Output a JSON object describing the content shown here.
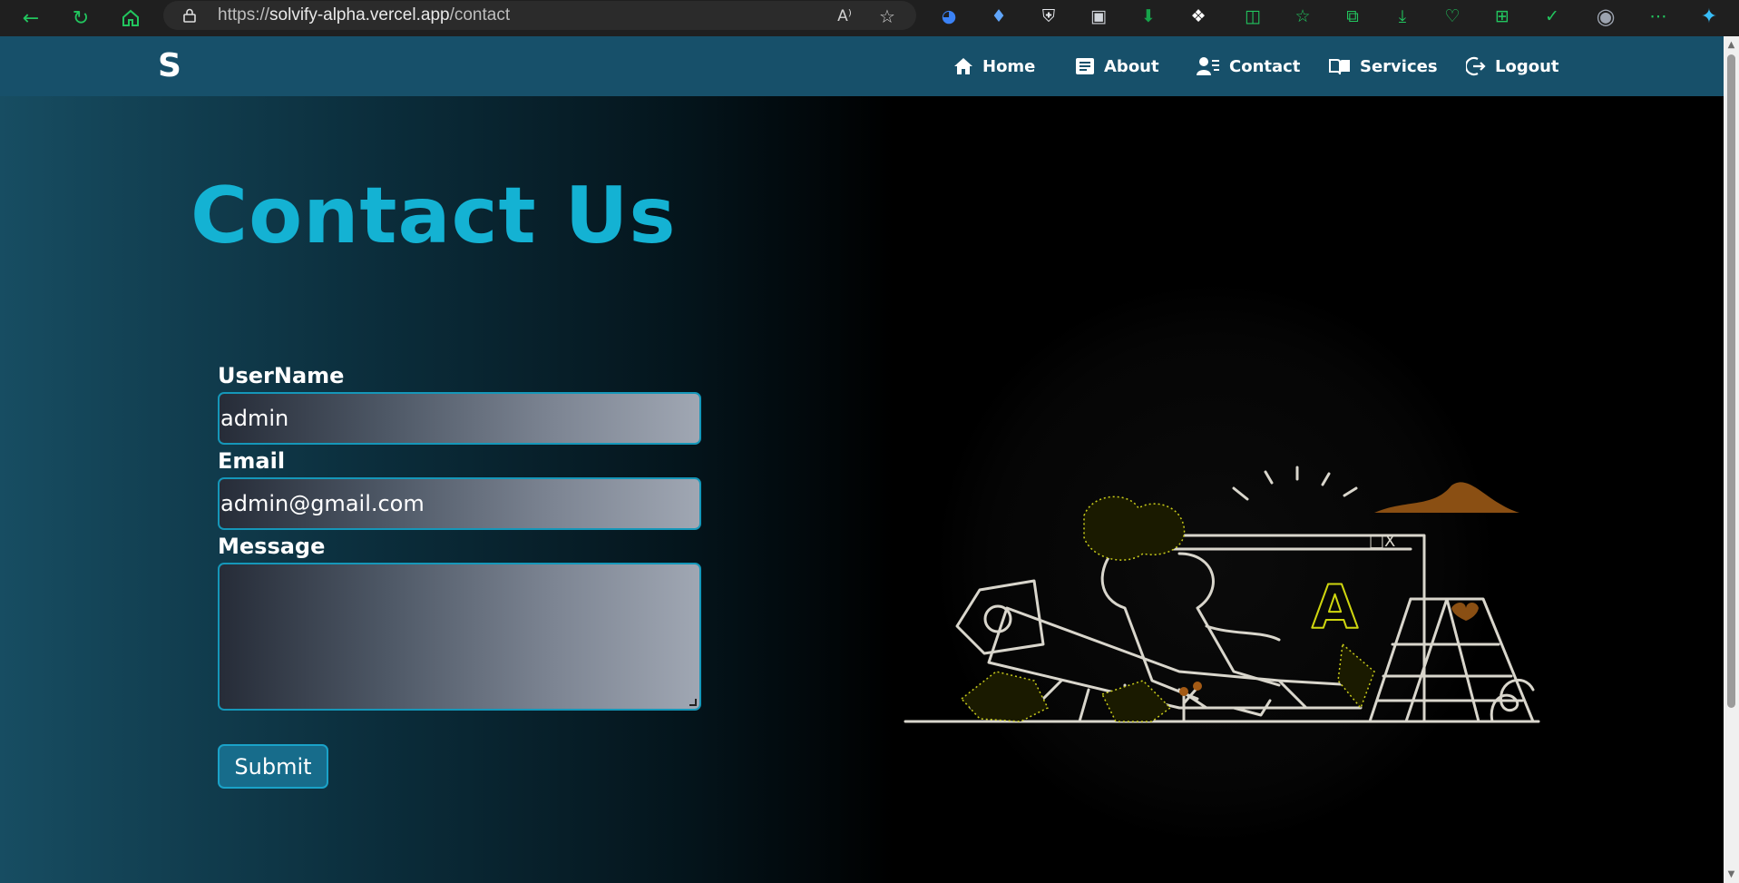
{
  "browser": {
    "url_scheme": "https://",
    "url_host": "solvify-alpha.vercel.app",
    "url_path": "/contact"
  },
  "navbar": {
    "logo": "S",
    "items": [
      {
        "label": "Home",
        "icon": "home-icon"
      },
      {
        "label": "About",
        "icon": "about-icon"
      },
      {
        "label": "Contact",
        "icon": "contact-icon"
      },
      {
        "label": "Services",
        "icon": "book-icon"
      },
      {
        "label": "Logout",
        "icon": "logout-icon"
      }
    ]
  },
  "main": {
    "title": "Contact Us",
    "form": {
      "username_label": "UserName",
      "username_value": "admin",
      "email_label": "Email",
      "email_value": "admin@gmail.com",
      "message_label": "Message",
      "message_value": "",
      "submit_label": "Submit"
    },
    "illustration": {
      "icon": "contact-illustration",
      "letter": "A"
    }
  },
  "colors": {
    "title": "#14b2d3",
    "navbar": "#17506a",
    "accent": "#1597b9"
  }
}
